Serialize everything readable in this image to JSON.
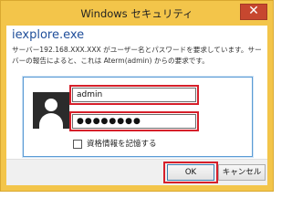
{
  "window": {
    "title": "Windows セキュリティ",
    "close_label": "✕"
  },
  "dialog": {
    "app_name": "iexplore.exe",
    "message": "サーバー192.168.XXX.XXX がユーザー名とパスワードを要求しています。サーバーの報告によると、これは Aterm(admin) からの要求です。"
  },
  "credentials": {
    "username_value": "admin",
    "password_value": "●●●●●●●●",
    "remember_label": "資格情報を記憶する",
    "remember_checked": false
  },
  "buttons": {
    "ok_label": "OK",
    "cancel_label": "キャンセル"
  },
  "colors": {
    "frame": "#f3c54a",
    "title_link": "#1f4e9a",
    "highlight": "#d61f2a",
    "close": "#c7472f"
  }
}
